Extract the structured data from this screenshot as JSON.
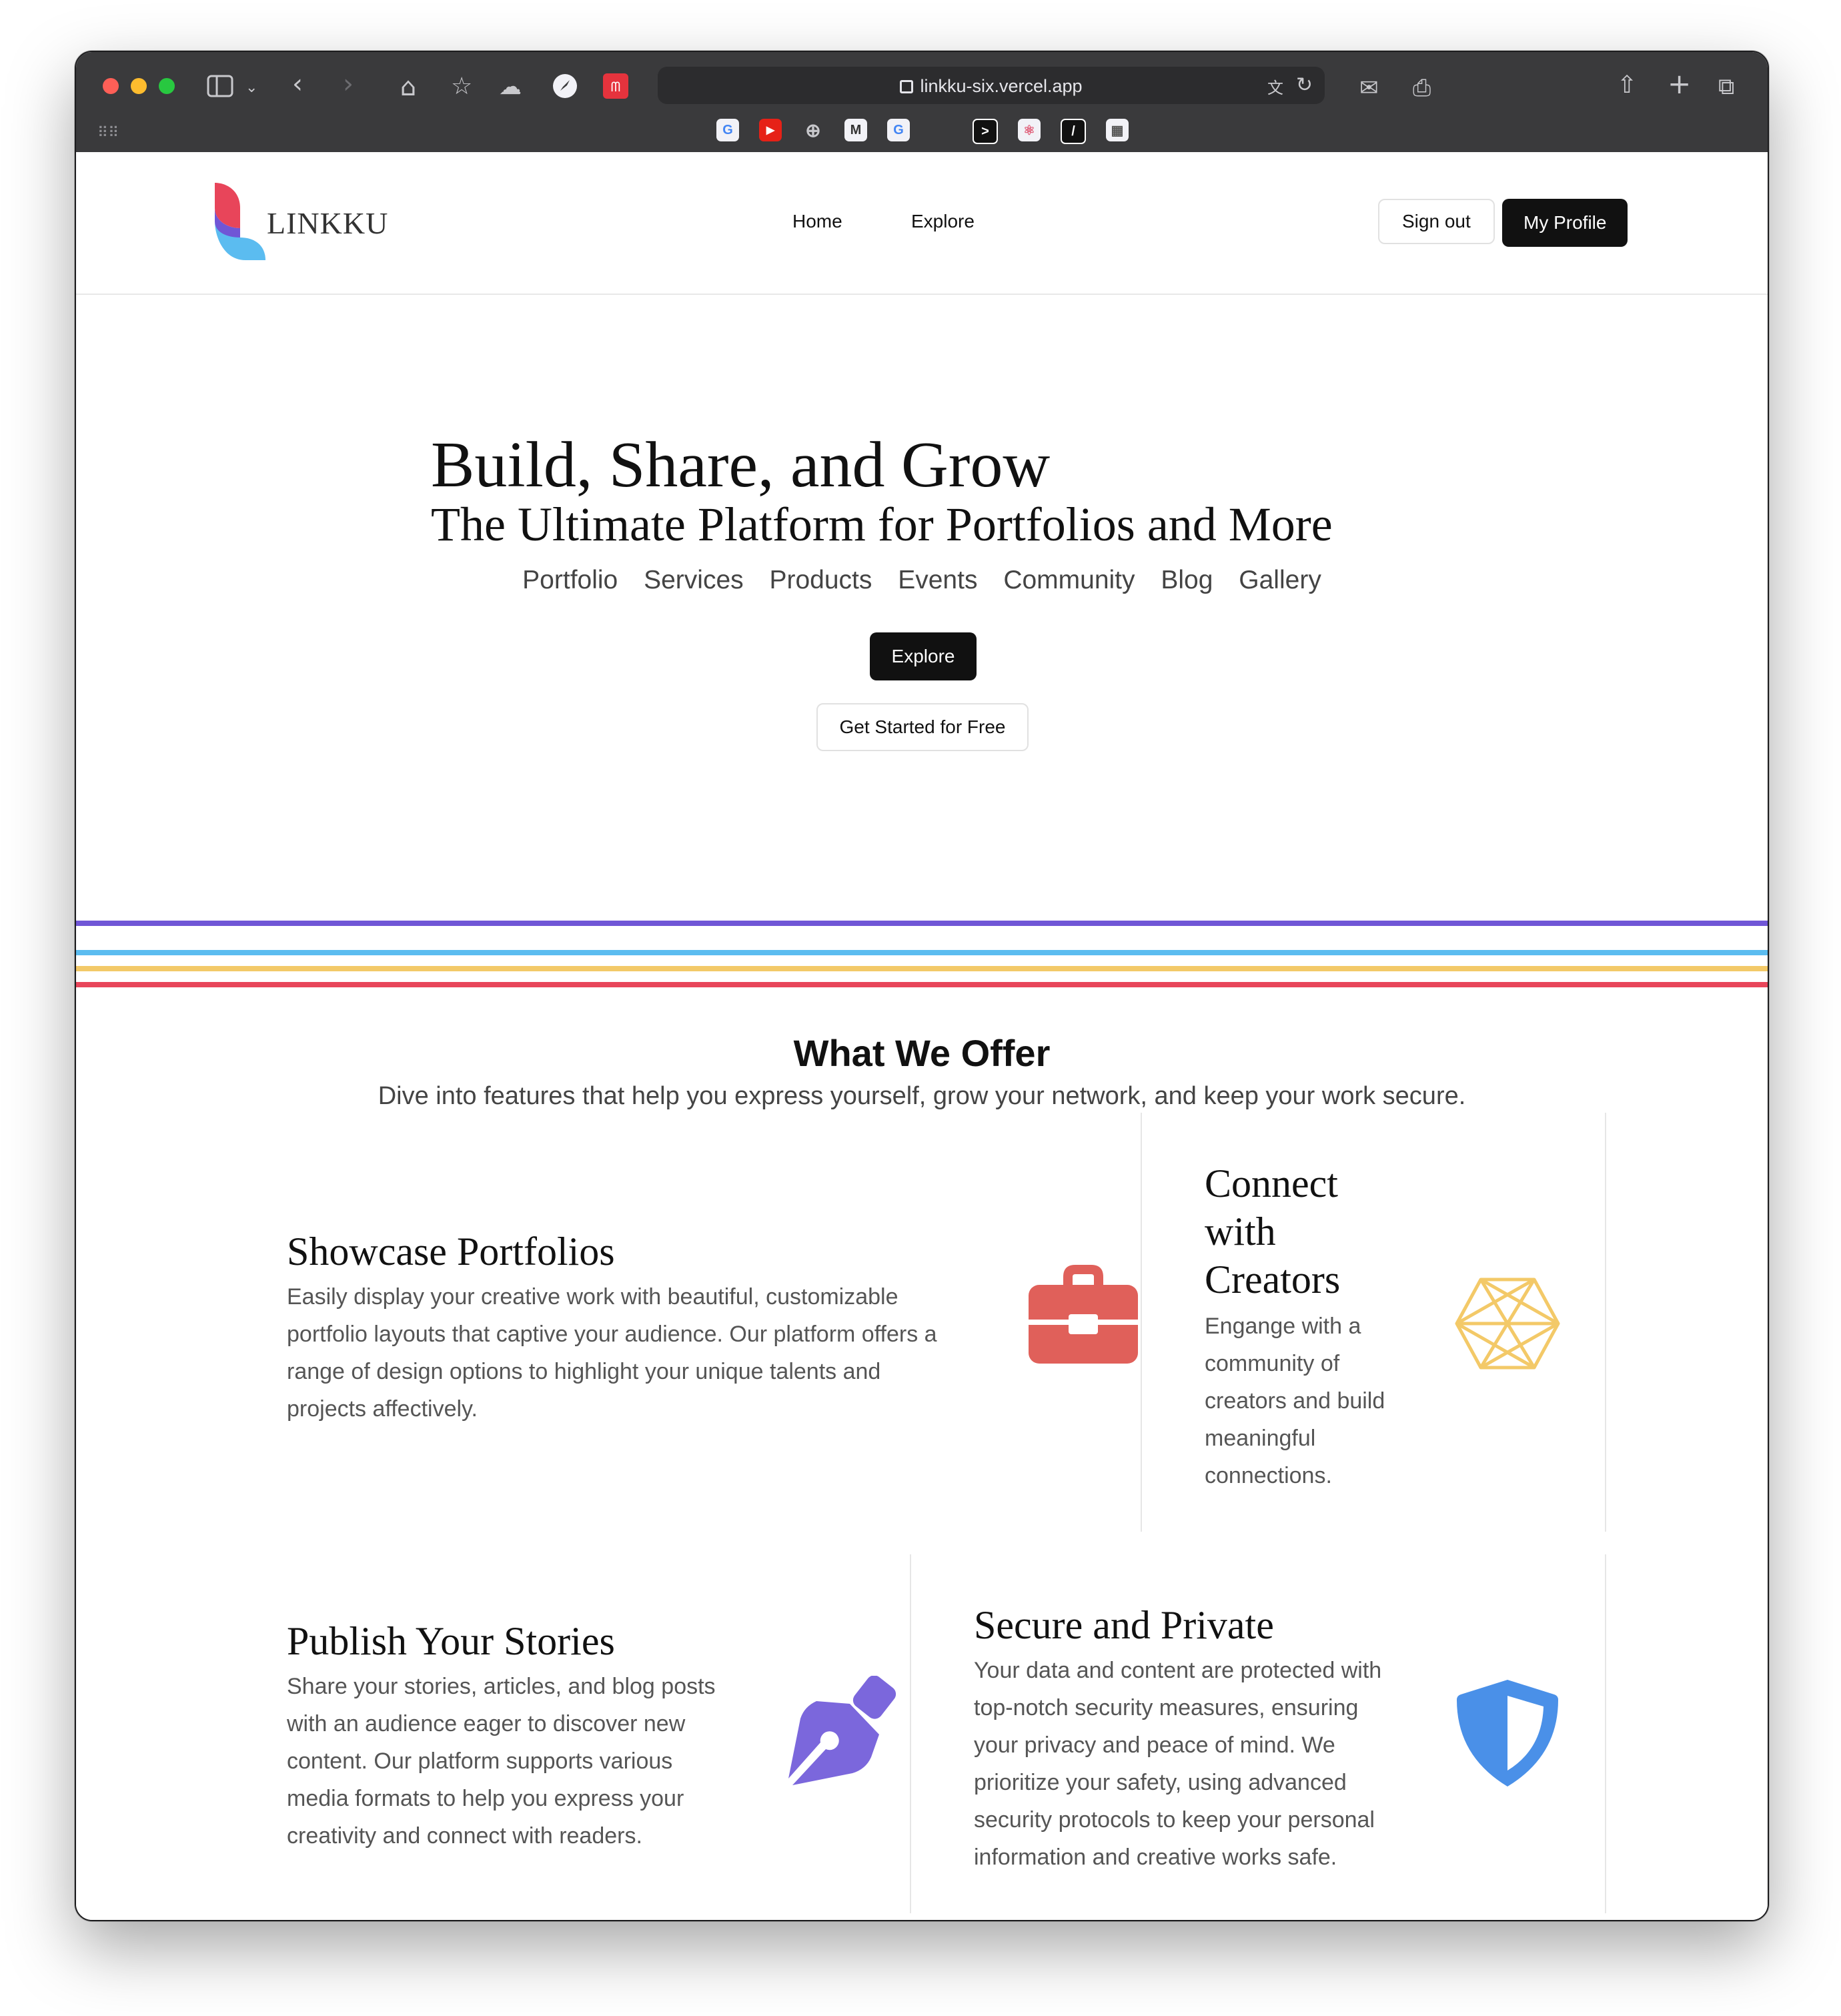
{
  "browser": {
    "url": "linkku-six.vercel.app",
    "favorites": [
      "G",
      "▶",
      "⊕",
      "M",
      "G",
      "",
      ">",
      "⚛",
      "/",
      "▦"
    ]
  },
  "site": {
    "logo_text": "LINKKU",
    "nav": {
      "home": "Home",
      "explore": "Explore"
    },
    "buttons": {
      "sign_out": "Sign out",
      "my_profile": "My Profile"
    }
  },
  "hero": {
    "title": "Build, Share, and Grow",
    "subtitle": "The Ultimate Platform for Portfolios and More",
    "categories": [
      "Portfolio",
      "Services",
      "Products",
      "Events",
      "Community",
      "Blog",
      "Gallery"
    ],
    "explore_label": "Explore",
    "start_label": "Get Started for Free"
  },
  "stripes": [
    "#7056d6",
    "#5bbcf0",
    "#f3c968",
    "#e8455a"
  ],
  "offer": {
    "title": "What We Offer",
    "subtitle": "Dive into features that help you express yourself, grow your network, and keep your work secure.",
    "features": [
      {
        "title": "Showcase Portfolios",
        "lines": [
          "Easily display your creative work with beautiful, customizable",
          "portfolio layouts that captive your audience. Our platform offers a",
          "range of design options to highlight your unique talents and",
          "projects affectively."
        ],
        "icon": "briefcase-icon",
        "color": "#e0605a"
      },
      {
        "title_lines": [
          "Connect",
          "with",
          "Creators"
        ],
        "lines": [
          "Engange with a",
          "community of",
          "creators and build",
          "meaningful",
          "connections."
        ],
        "icon": "network-hexagon-icon",
        "color": "#f3c968"
      },
      {
        "title": "Publish Your Stories",
        "lines": [
          "Share your stories, articles, and blog posts",
          "with an audience eager to discover new",
          "content. Our platform supports various",
          "media formats to help you express your",
          "creativity and connect with readers."
        ],
        "icon": "pen-nib-icon",
        "color": "#7b67dc"
      },
      {
        "title": "Secure and Private",
        "lines": [
          "Your data and content are protected with",
          "top-notch security measures, ensuring",
          "your privacy and peace of mind. We",
          "prioritize your safety, using advanced",
          "security protocols to keep your personal",
          "information and creative works safe."
        ],
        "icon": "shield-icon",
        "color": "#4a90e8"
      }
    ]
  }
}
